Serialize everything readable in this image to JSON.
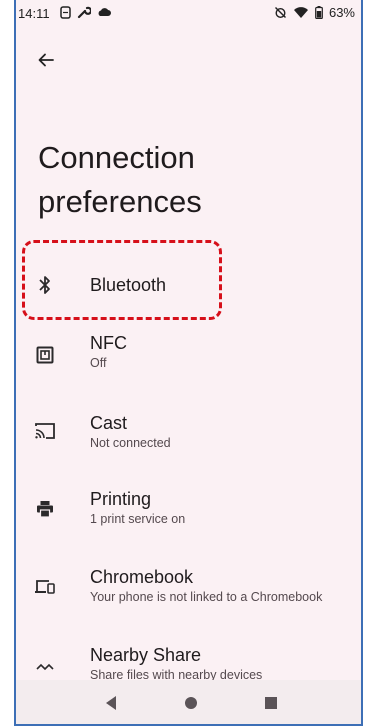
{
  "status_bar": {
    "time": "14:11",
    "battery": "63%"
  },
  "page": {
    "title": "Connection preferences"
  },
  "items": [
    {
      "title": "Bluetooth",
      "subtitle": "",
      "icon": "bluetooth-icon"
    },
    {
      "title": "NFC",
      "subtitle": "Off",
      "icon": "nfc-icon"
    },
    {
      "title": "Cast",
      "subtitle": "Not connected",
      "icon": "cast-icon"
    },
    {
      "title": "Printing",
      "subtitle": "1 print service on",
      "icon": "printer-icon"
    },
    {
      "title": "Chromebook",
      "subtitle": "Your phone is not linked to a Chromebook",
      "icon": "chromebook-icon"
    },
    {
      "title": "Nearby Share",
      "subtitle": "Share files with nearby devices",
      "icon": "nearby-share-icon"
    }
  ],
  "colors": {
    "background": "#fbf1f4",
    "highlight": "#d6101a",
    "frame_border": "#3d6fb6"
  }
}
